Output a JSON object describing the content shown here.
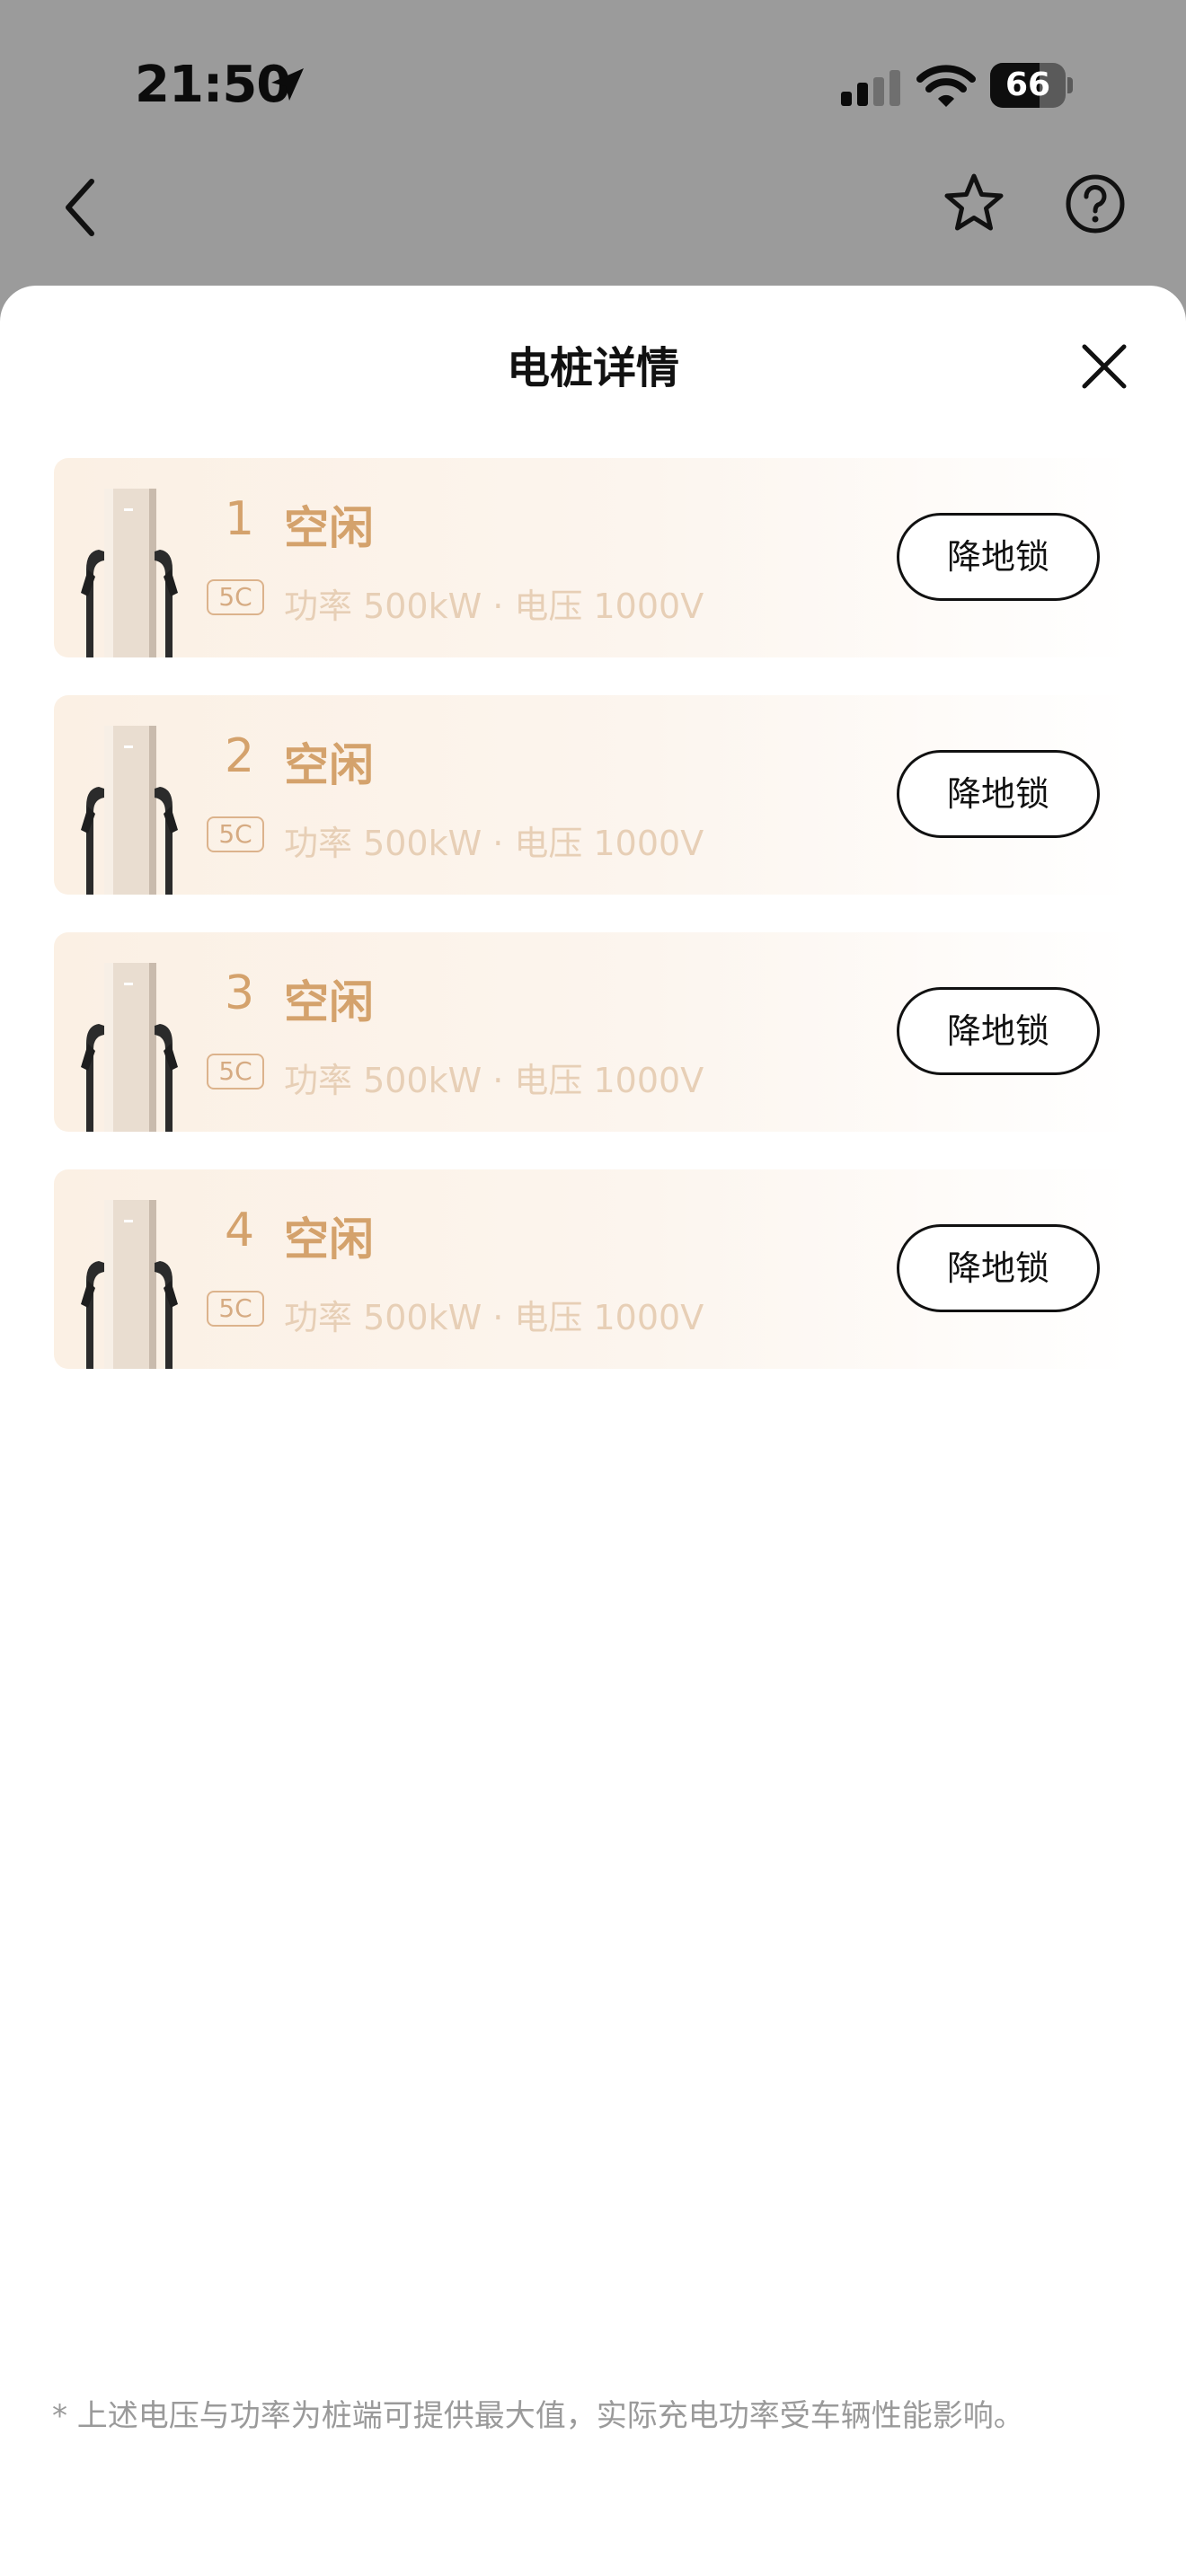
{
  "status_bar": {
    "time": "21:50",
    "battery_level": "66",
    "icons": [
      "location-arrow-icon",
      "signal-icon",
      "wifi-icon",
      "battery-icon"
    ]
  },
  "nav": {
    "icons": [
      "back-chevron-icon",
      "favorite-star-icon",
      "help-icon"
    ]
  },
  "sheet": {
    "title": "电桩详情",
    "close_icon": "close-icon"
  },
  "chargers": [
    {
      "number": "1",
      "status": "空闲",
      "rate_badge": "5C",
      "spec": "功率 500kW · 电压 1000V",
      "action": "降地锁"
    },
    {
      "number": "2",
      "status": "空闲",
      "rate_badge": "5C",
      "spec": "功率 500kW · 电压 1000V",
      "action": "降地锁"
    },
    {
      "number": "3",
      "status": "空闲",
      "rate_badge": "5C",
      "spec": "功率 500kW · 电压 1000V",
      "action": "降地锁"
    },
    {
      "number": "4",
      "status": "空闲",
      "rate_badge": "5C",
      "spec": "功率 500kW · 电压 1000V",
      "action": "降地锁"
    }
  ],
  "footnote": "* 上述电压与功率为桩端可提供最大值，实际充电功率受车辆性能影响。",
  "colors": {
    "accent": "#d4a26c",
    "card_bg": "#fbf0e4",
    "overlay": "#9b9b9b"
  }
}
